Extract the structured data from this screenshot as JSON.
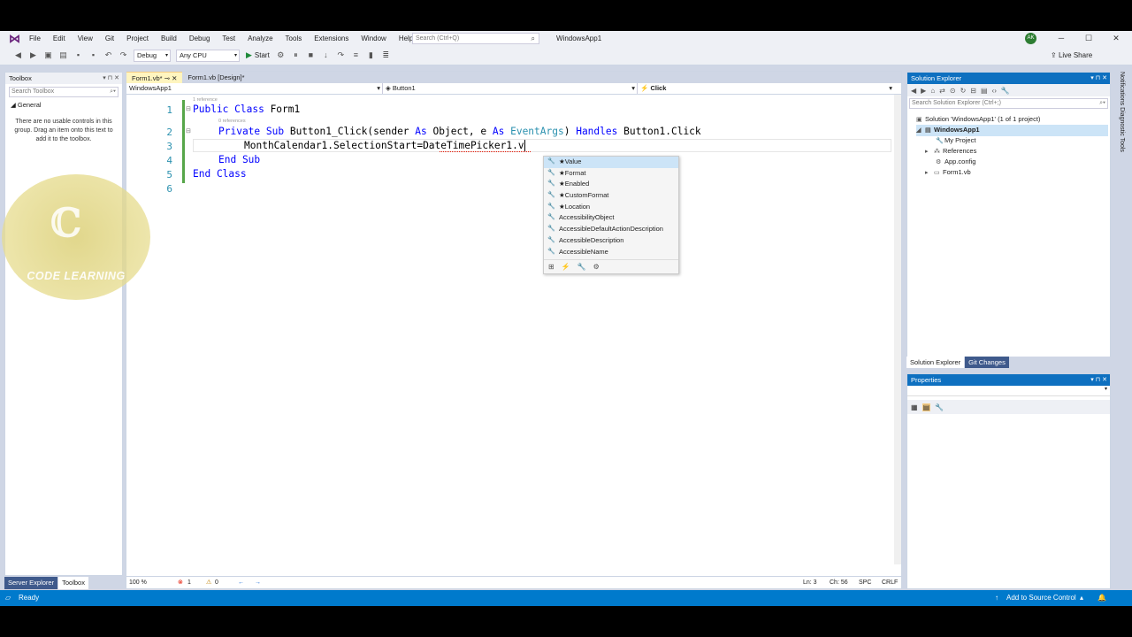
{
  "menubar": {
    "items": [
      "File",
      "Edit",
      "View",
      "Git",
      "Project",
      "Build",
      "Debug",
      "Test",
      "Analyze",
      "Tools",
      "Extensions",
      "Window",
      "Help"
    ],
    "search_placeholder": "Search (Ctrl+Q)",
    "solution_title": "WindowsApp1",
    "avatar_initials": "AK"
  },
  "toolbar": {
    "config": "Debug",
    "platform": "Any CPU",
    "start_label": "Start",
    "live_share": "Live Share"
  },
  "toolbox": {
    "title": "Toolbox",
    "search_placeholder": "Search Toolbox",
    "group": "General",
    "message": "There are no usable controls in this group. Drag an item onto this text to add it to the toolbox.",
    "tabs": [
      "Server Explorer",
      "Toolbox"
    ]
  },
  "editor": {
    "tabs": [
      "Form1.vb*",
      "Form1.vb [Design]*"
    ],
    "nav": {
      "project": "WindowsApp1",
      "object": "Button1",
      "event": "Click"
    },
    "codelens": [
      "1 reference",
      "0 references"
    ],
    "line_numbers": [
      "1",
      "2",
      "3",
      "4",
      "5",
      "6"
    ],
    "lines": {
      "l1": {
        "kw": "Public Class",
        "name": " Form1"
      },
      "l2": {
        "kw": "Private Sub",
        "rest": " Button1_Click(sender ",
        "as1": "As",
        "t1": " Object, e ",
        "as2": "As",
        "t2": " ",
        "evt": "EventArgs",
        "t3": ") ",
        "hd": "Handles",
        "t4": " Button1.Click"
      },
      "l3": "MonthCalendar1.SelectionStart=DateTimePicker1.v",
      "l4": {
        "kw": "End Sub"
      },
      "l5": {
        "kw": "End Class"
      }
    },
    "zoom": "100 %",
    "errors": "1",
    "warnings": "0",
    "position": {
      "ln": "Ln: 3",
      "ch": "Ch: 56",
      "spc": "SPC",
      "crlf": "CRLF"
    }
  },
  "intellisense": {
    "items": [
      "Value",
      "Format",
      "Enabled",
      "CustomFormat",
      "Location",
      "AccessibilityObject",
      "AccessibleDefaultActionDescription",
      "AccessibleDescription",
      "AccessibleName"
    ],
    "selected": "Value"
  },
  "solution_explorer": {
    "title": "Solution Explorer",
    "search_placeholder": "Search Solution Explorer (Ctrl+;)",
    "tree": [
      "Solution 'WindowsApp1' (1 of 1 project)",
      "WindowsApp1",
      "My Project",
      "References",
      "App.config",
      "Form1.vb"
    ],
    "tabs": [
      "Solution Explorer",
      "Git Changes"
    ]
  },
  "properties": {
    "title": "Properties"
  },
  "side_rail": "Notifications   Diagnostic Tools",
  "status": {
    "ready": "Ready",
    "source_control": "Add to Source Control"
  },
  "watermark": {
    "text": "CODE LEARNING"
  }
}
